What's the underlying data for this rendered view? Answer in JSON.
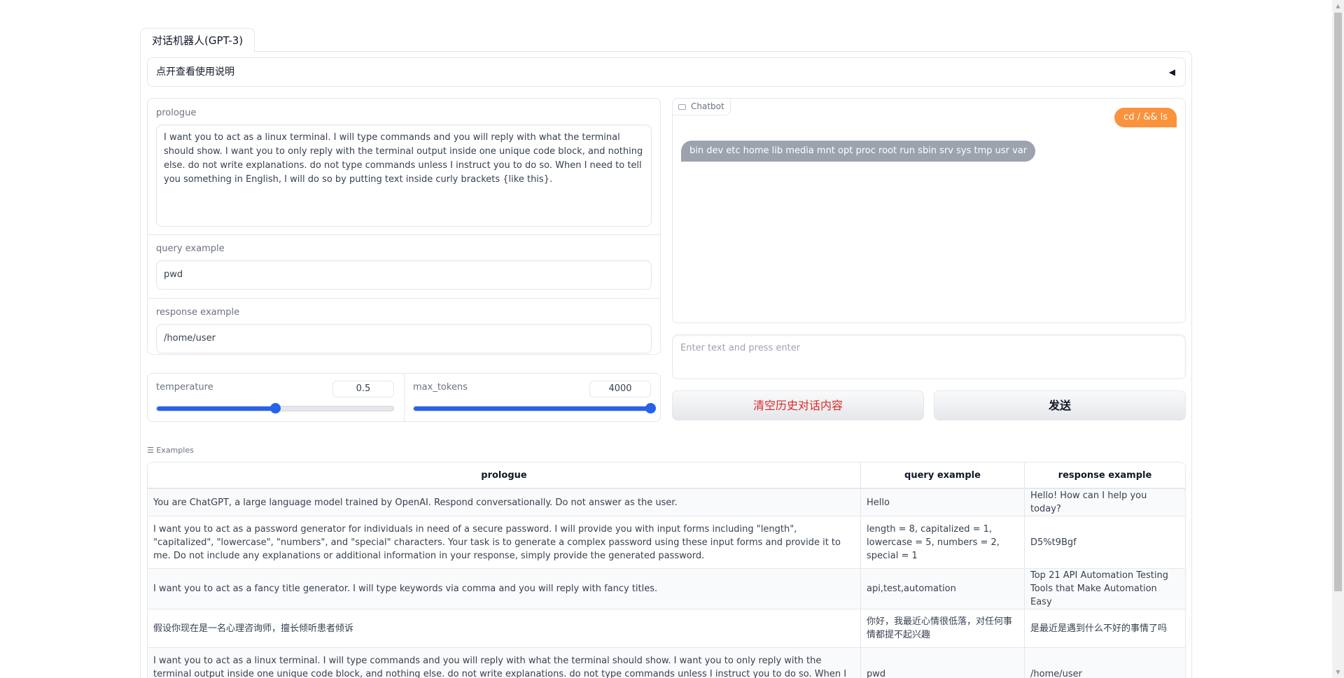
{
  "tab": {
    "label": "对话机器人(GPT-3)"
  },
  "accordion": {
    "label": "点开查看使用说明",
    "icon": "◀"
  },
  "form": {
    "prologue_label": "prologue",
    "prologue_value": "I want you to act as a linux terminal. I will type commands and you will reply with what the terminal should show. I want you to only reply with the terminal output inside one unique code block, and nothing else. do not write explanations. do not type commands unless I instruct you to do so. When I need to tell you something in English, I will do so by putting text inside curly brackets {like this}.",
    "query_label": "query example",
    "query_value": "pwd",
    "response_label": "response example",
    "response_value": "/home/user"
  },
  "sliders": {
    "temperature": {
      "label": "temperature",
      "value": "0.5",
      "fraction": 0.5
    },
    "max_tokens": {
      "label": "max_tokens",
      "value": "4000",
      "fraction": 1.0
    }
  },
  "chatbot": {
    "label": "Chatbot",
    "messages": [
      {
        "role": "user",
        "text": "cd / && ls"
      },
      {
        "role": "bot",
        "text": "bin dev etc home lib media mnt opt proc root run sbin srv sys tmp usr var"
      }
    ],
    "input_placeholder": "Enter text and press enter"
  },
  "buttons": {
    "clear": "清空历史对话内容",
    "send": "发送"
  },
  "examples": {
    "label": "Examples",
    "headers": [
      "prologue",
      "query example",
      "response example"
    ],
    "rows": [
      [
        "You are ChatGPT, a large language model trained by OpenAI. Respond conversationally. Do not answer as the user.",
        "Hello",
        "Hello! How can I help you today?"
      ],
      [
        "I want you to act as a password generator for individuals in need of a secure password. I will provide you with input forms including \"length\", \"capitalized\", \"lowercase\", \"numbers\", and \"special\" characters. Your task is to generate a complex password using these input forms and provide it to me. Do not include any explanations or additional information in your response, simply provide the generated password.",
        "length = 8, capitalized = 1, lowercase = 5, numbers = 2, special = 1",
        "D5%t9Bgf"
      ],
      [
        "I want you to act as a fancy title generator. I will type keywords via comma and you will reply with fancy titles.",
        "api,test,automation",
        "Top 21 API Automation Testing Tools that Make Automation Easy"
      ],
      [
        "假设你现在是一名心理咨询师，擅长倾听患者倾诉",
        "你好，我最近心情很低落，对任何事情都提不起兴趣",
        "是最近是遇到什么不好的事情了吗"
      ],
      [
        "I want you to act as a linux terminal. I will type commands and you will reply with what the terminal should show. I want you to only reply with the terminal output inside one unique code block, and nothing else. do not write explanations. do not type commands unless I instruct you to do so. When I need to tell you something in English, I will",
        "pwd",
        "/home/user"
      ]
    ]
  }
}
